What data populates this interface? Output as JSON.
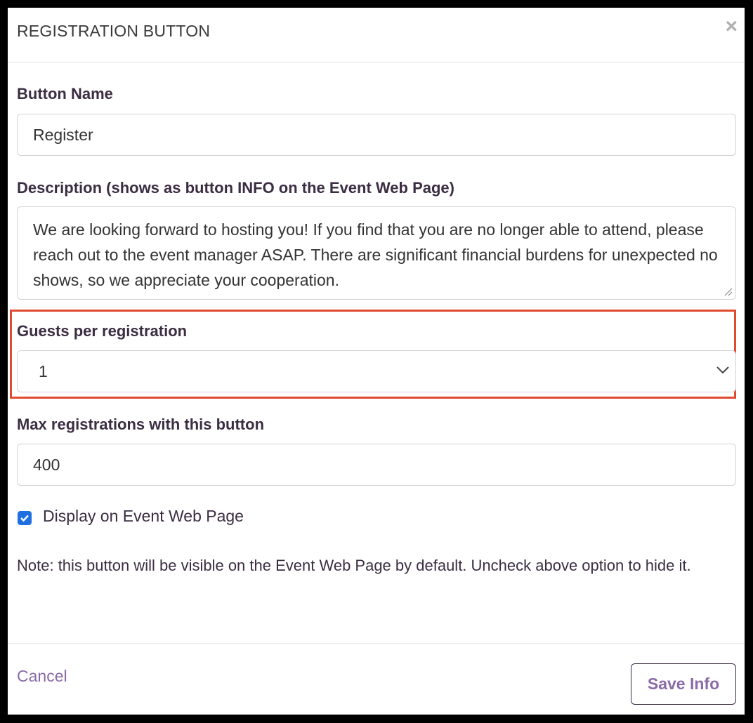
{
  "modal": {
    "title": "REGISTRATION BUTTON",
    "close_icon": "×"
  },
  "fields": {
    "button_name": {
      "label": "Button Name",
      "value": "Register"
    },
    "description": {
      "label": "Description (shows as button INFO on the Event Web Page)",
      "value": "We are looking forward to hosting you! If you find that you are no longer able to attend, please reach out to the event manager ASAP. There are significant financial burdens for unexpected no shows, so we appreciate your cooperation."
    },
    "guests": {
      "label": "Guests per registration",
      "selected": "1"
    },
    "max_registrations": {
      "label": "Max registrations with this button",
      "value": "400"
    },
    "display": {
      "label": "Display on Event Web Page",
      "checked": true
    }
  },
  "note": "Note: this button will be visible on the Event Web Page by default. Uncheck above option to hide it.",
  "footer": {
    "cancel_label": "Cancel",
    "save_label": "Save Info"
  },
  "colors": {
    "highlight": "#e04a2f",
    "accent": "#8b6aa8",
    "checkbox": "#1f6fe0",
    "label_text": "#3b2d42"
  }
}
